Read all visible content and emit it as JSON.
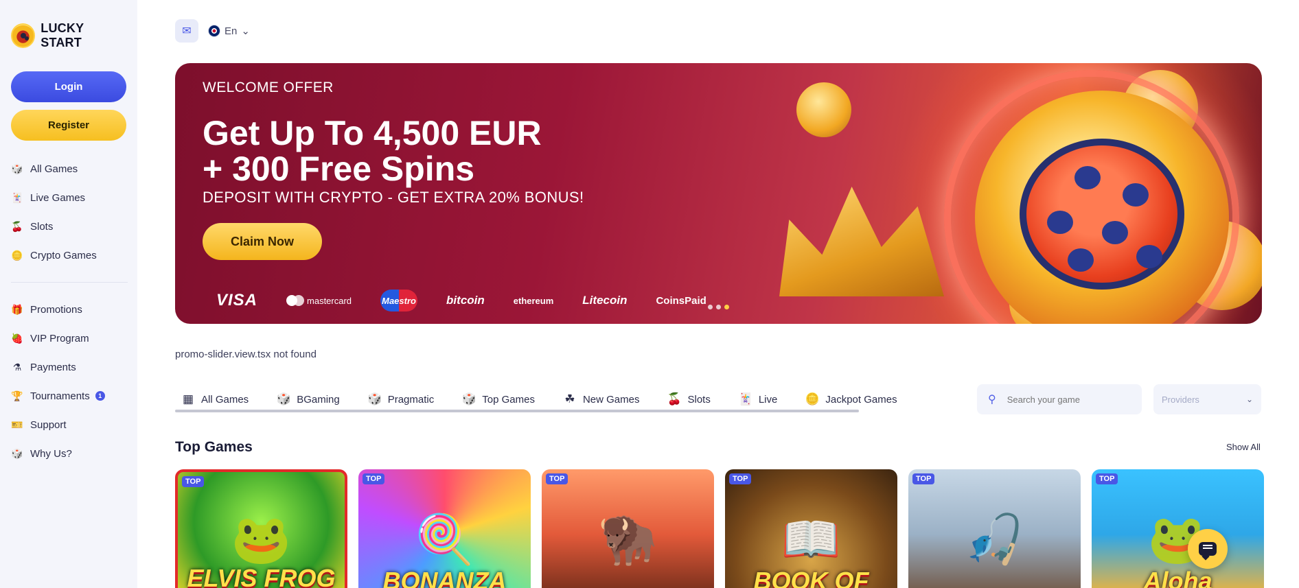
{
  "brand": {
    "name": "LUCKY START"
  },
  "auth": {
    "login": "Login",
    "register": "Register"
  },
  "sidebar": {
    "main": [
      {
        "label": "All Games",
        "icon": "dice-icon"
      },
      {
        "label": "Live Games",
        "icon": "cards-icon"
      },
      {
        "label": "Slots",
        "icon": "cherry-icon"
      },
      {
        "label": "Crypto Games",
        "icon": "coin-icon"
      }
    ],
    "secondary": [
      {
        "label": "Promotions",
        "icon": "gift-icon"
      },
      {
        "label": "VIP Program",
        "icon": "strawberry-icon"
      },
      {
        "label": "Payments",
        "icon": "flask-icon"
      },
      {
        "label": "Tournaments",
        "icon": "trophy-icon",
        "badge": "1"
      },
      {
        "label": "Support",
        "icon": "support-icon"
      },
      {
        "label": "Why Us?",
        "icon": "dice-icon"
      }
    ]
  },
  "topbar": {
    "language": "En"
  },
  "banner": {
    "welcome": "WELCOME OFFER",
    "headline_line1": "Get Up To 4,500 EUR",
    "headline_line2": "+ 300 Free Spins",
    "subline": "DEPOSIT WITH CRYPTO - GET EXTRA 20% BONUS!",
    "cta": "Claim Now",
    "payments": [
      "VISA",
      "mastercard",
      "Maestro",
      "bitcoin",
      "ethereum",
      "Litecoin",
      "CoinsPaid"
    ],
    "slide_count": 3,
    "active_slide": 3
  },
  "notice": "promo-slider.view.tsx not found",
  "tabs": [
    {
      "label": "All Games",
      "icon": "grid-icon"
    },
    {
      "label": "BGaming",
      "icon": "dice-icon"
    },
    {
      "label": "Pragmatic",
      "icon": "dice-icon"
    },
    {
      "label": "Top Games",
      "icon": "dice-icon"
    },
    {
      "label": "New Games",
      "icon": "clover-icon"
    },
    {
      "label": "Slots",
      "icon": "cherry-icon"
    },
    {
      "label": "Live",
      "icon": "cards-icon"
    },
    {
      "label": "Jackpot Games",
      "icon": "coin-icon"
    }
  ],
  "search": {
    "placeholder": "Search your game"
  },
  "providers": {
    "placeholder": "Providers"
  },
  "section": {
    "title": "Top Games",
    "show_all": "Show All"
  },
  "games": [
    {
      "badge": "TOP",
      "title": "ELVIS FROG"
    },
    {
      "badge": "TOP",
      "title": "BONANZA"
    },
    {
      "badge": "TOP",
      "title": ""
    },
    {
      "badge": "TOP",
      "title": "BOOK OF"
    },
    {
      "badge": "TOP",
      "title": ""
    },
    {
      "badge": "TOP",
      "title": "Aloha"
    }
  ]
}
